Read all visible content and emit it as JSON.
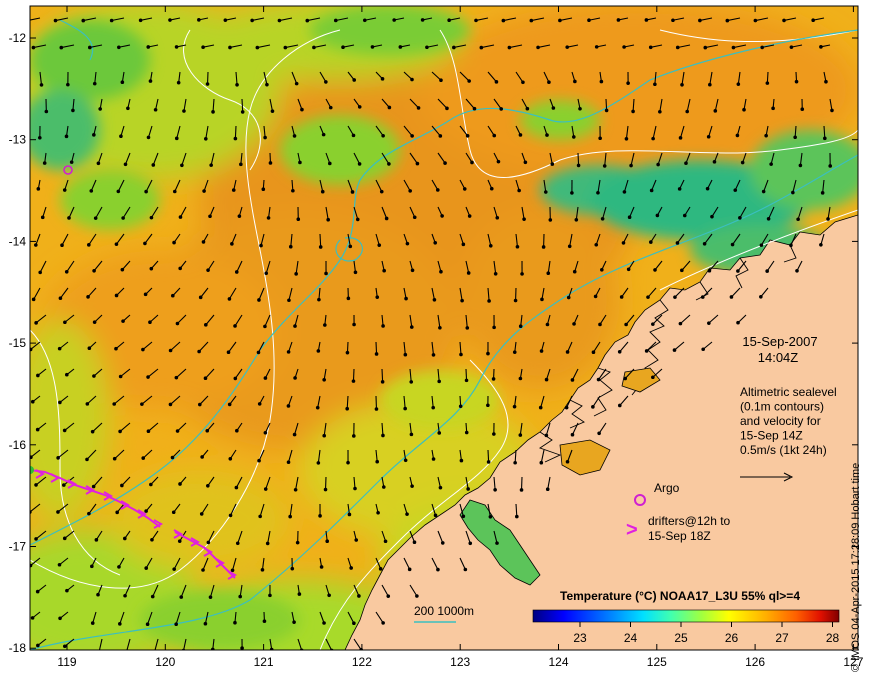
{
  "map": {
    "lat_ticks": [
      "-12",
      "-13",
      "-14",
      "-15",
      "-16",
      "-17",
      "-18"
    ],
    "lon_ticks": [
      "119",
      "120",
      "121",
      "122",
      "123",
      "124",
      "125",
      "126",
      "127"
    ],
    "colors": {
      "land": "#f9c9a0",
      "sea_warm": "#e99a1c",
      "sea_mid": "#f2b81a",
      "sea_cool": "#9ad82a",
      "sea_cold": "#2fb880",
      "contour": "#ffffff",
      "isobath": "#3bbfc0",
      "vector": "#000000",
      "drifter": "#e020e0",
      "argo": "#d020d0"
    }
  },
  "info": {
    "date": "15-Sep-2007",
    "time": "14:04Z",
    "altimetry_lines": [
      "Altimetric sealevel",
      "(0.1m contours)",
      "and velocity for",
      "15-Sep 14Z",
      "0.5m/s (1kt 24h)"
    ],
    "argo_label": "Argo",
    "drifters_lines": [
      "drifters@12h to",
      "15-Sep 18Z"
    ],
    "drifter_symbol": ">"
  },
  "colorbar": {
    "title": "Temperature (°C) NOAA17_L3U 55% ql>=4",
    "ticks": [
      "23",
      "24",
      "25",
      "26",
      "27",
      "28"
    ],
    "colors": [
      "#000080",
      "#0000ff",
      "#0080ff",
      "#00e0ff",
      "#40ffb0",
      "#a0ff40",
      "#ffff00",
      "#ffb000",
      "#ff6000",
      "#e01000",
      "#800000"
    ]
  },
  "scale_legend": {
    "label": "200  1000m"
  },
  "credit": "© IMOS 04-Apr-2015 17:28:09 Hobart time"
}
